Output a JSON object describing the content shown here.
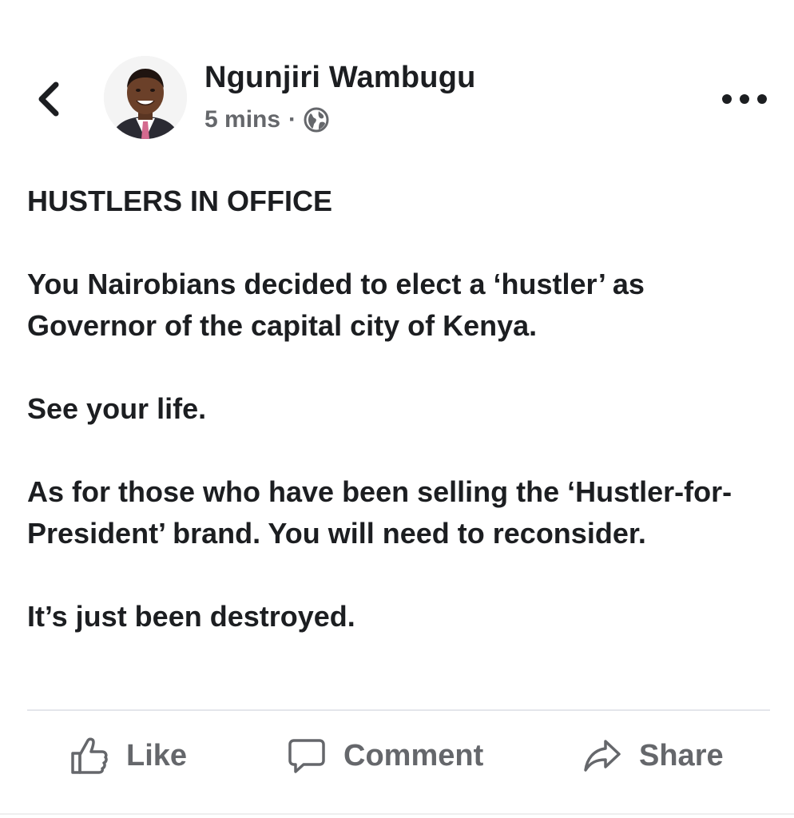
{
  "post": {
    "author": "Ngunjiri Wambugu",
    "time": "5 mins",
    "separator": "·",
    "privacy_icon": "globe-icon",
    "paragraphs": [
      "HUSTLERS IN OFFICE",
      "You Nairobians decided to elect a ‘hustler’ as Governor of the capital city of Kenya.",
      "See your life.",
      "As for those who have been selling the ‘Hustler-for-President’ brand. You will need to reconsider.",
      "It’s just been destroyed."
    ]
  },
  "actions": {
    "like_label": "Like",
    "comment_label": "Comment",
    "share_label": "Share"
  },
  "icons": {
    "back": "chevron-left-icon",
    "more": "more-horizontal-icon",
    "like": "thumbs-up-icon",
    "comment": "speech-bubble-icon",
    "share": "share-arrow-icon"
  },
  "colors": {
    "text": "#1c1e21",
    "secondary": "#65676b",
    "divider": "#e4e6eb"
  }
}
